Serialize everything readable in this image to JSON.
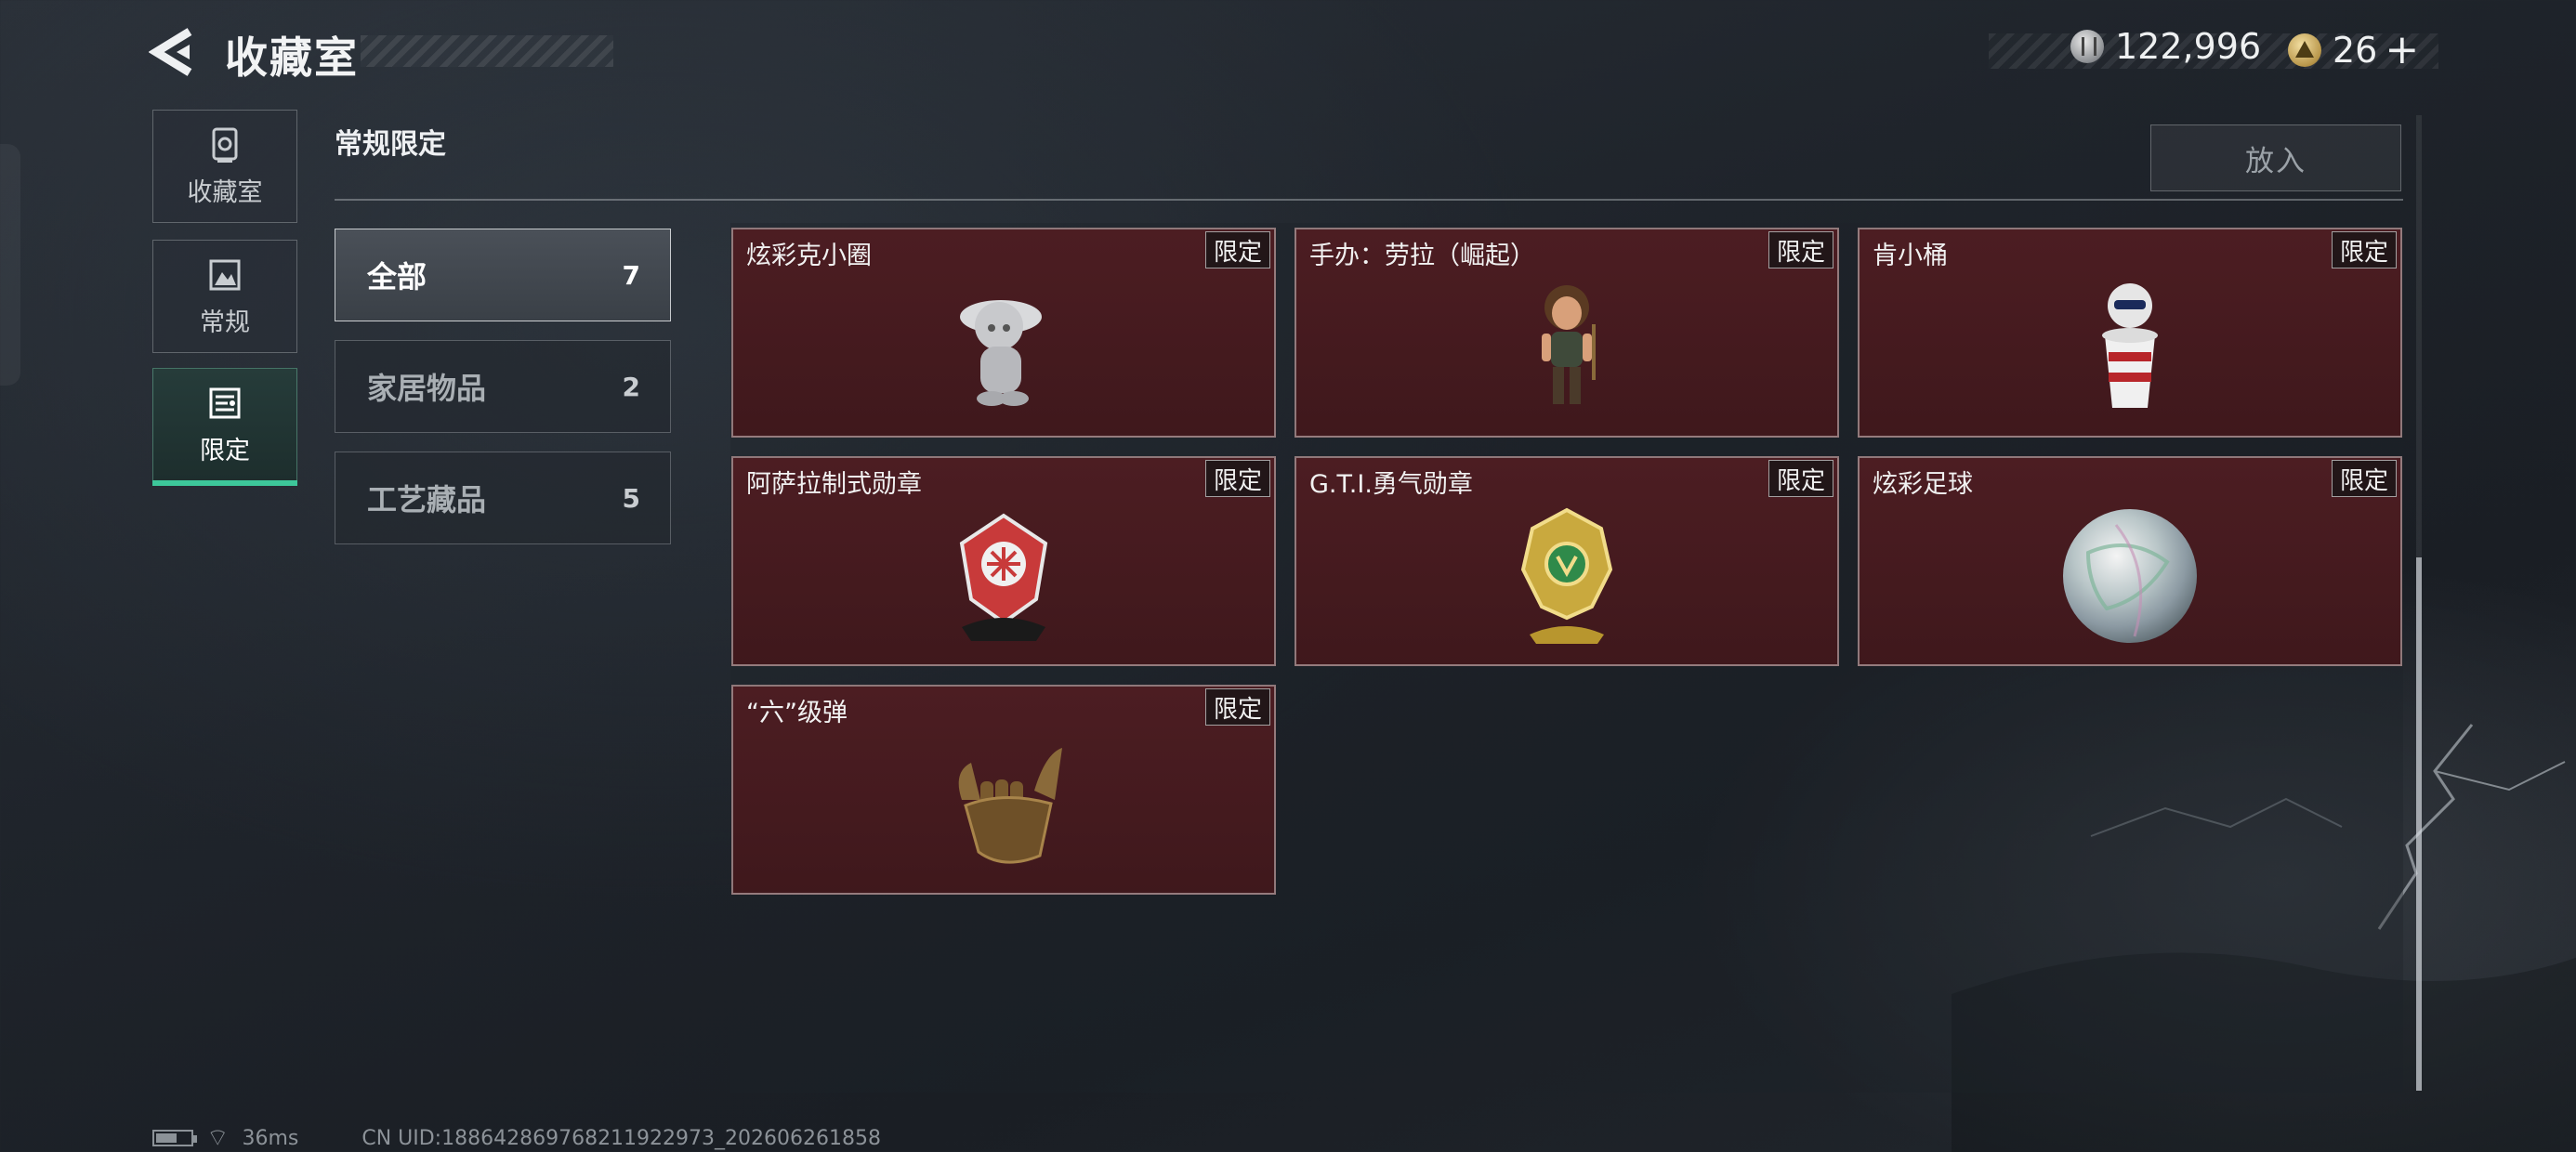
{
  "header": {
    "title": "收藏室",
    "currency_coin": "122,996",
    "currency_token": "26",
    "token_plus": "+"
  },
  "nav": [
    {
      "label": "收藏室",
      "icon": "collection-icon"
    },
    {
      "label": "常规",
      "icon": "regular-icon"
    },
    {
      "label": "限定",
      "icon": "limited-icon",
      "active": true
    }
  ],
  "section": {
    "title": "常规限定",
    "place_button": "放入"
  },
  "categories": [
    {
      "label": "全部",
      "count": "7",
      "active": true
    },
    {
      "label": "家居物品",
      "count": "2"
    },
    {
      "label": "工艺藏品",
      "count": "5"
    }
  ],
  "items": [
    {
      "name": "炫彩克小圈",
      "badge": "限定",
      "icon": "silver-figure-icon"
    },
    {
      "name": "手办：劳拉（崛起）",
      "badge": "限定",
      "icon": "lara-figure-icon"
    },
    {
      "name": "肯小桶",
      "badge": "限定",
      "icon": "bucket-figure-icon"
    },
    {
      "name": "阿萨拉制式勋章",
      "badge": "限定",
      "icon": "red-medal-icon"
    },
    {
      "name": "G.T.I.勇气勋章",
      "badge": "限定",
      "icon": "gold-medal-icon"
    },
    {
      "name": "炫彩足球",
      "badge": "限定",
      "icon": "iridescent-ball-icon"
    },
    {
      "name": "“六”级弹",
      "badge": "限定",
      "icon": "bronze-hand-icon"
    }
  ],
  "footer": {
    "ping": "36ms",
    "uid": "CN UID:188642869768211922973_202606261858"
  },
  "colors": {
    "accent": "#3dc79a",
    "card_bg": "#4c1d22"
  }
}
